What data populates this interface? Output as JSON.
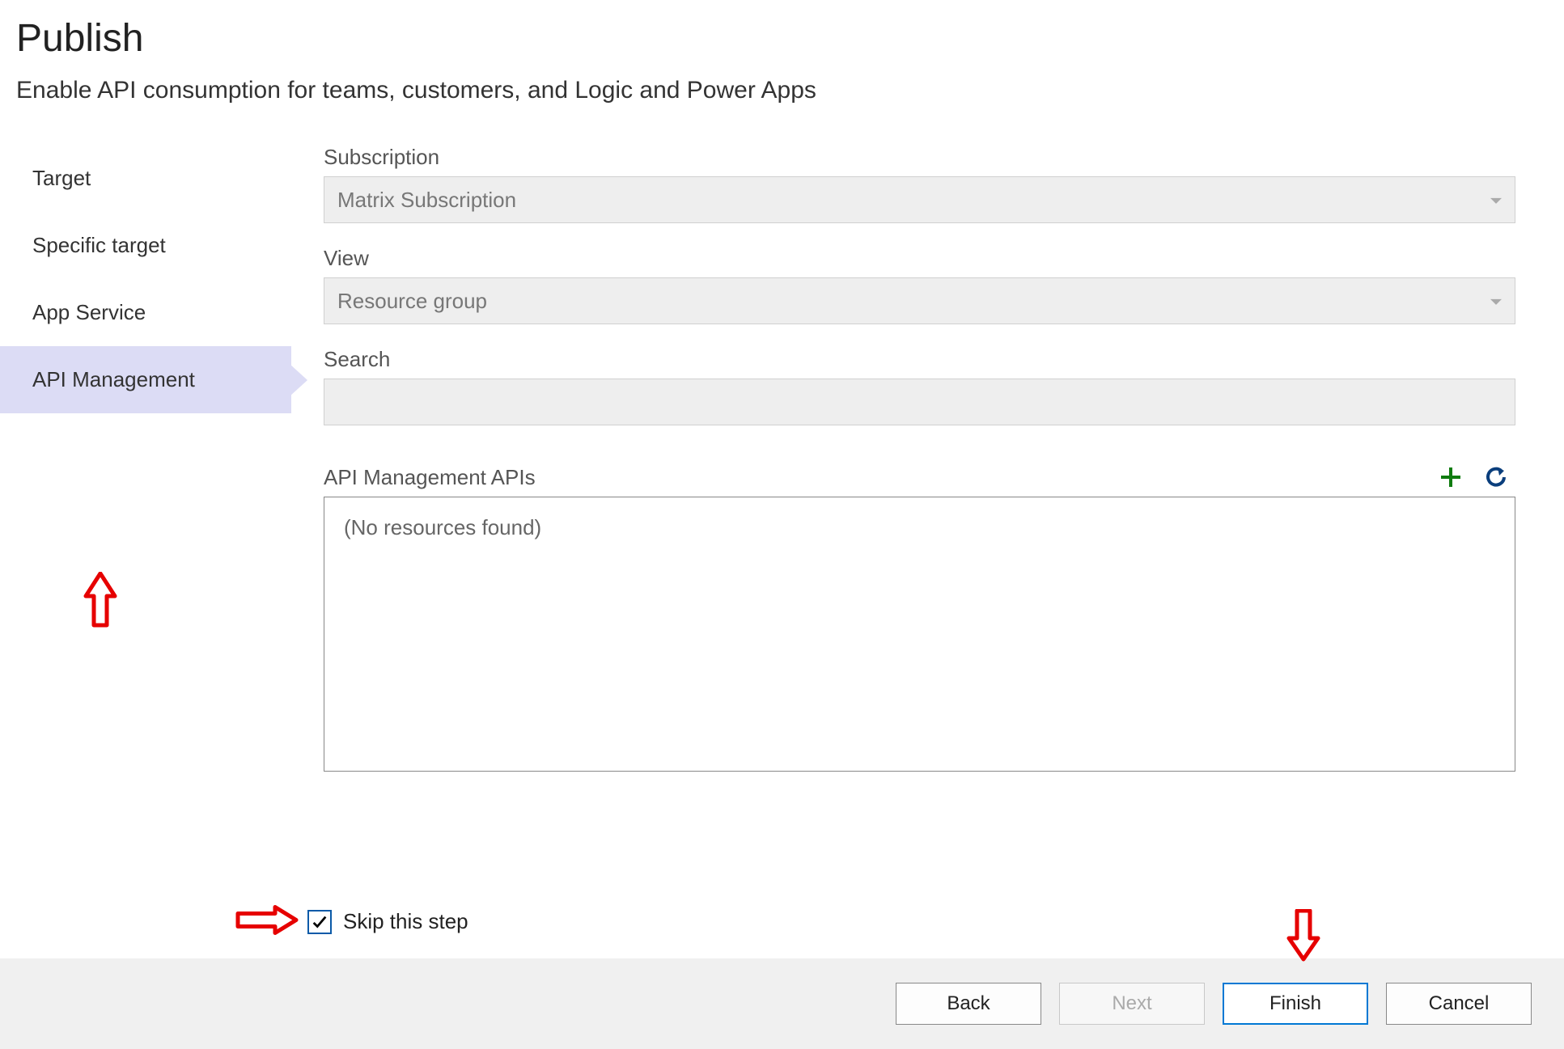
{
  "header": {
    "title": "Publish",
    "subtitle": "Enable API consumption for teams, customers, and Logic and Power Apps"
  },
  "sidebar": {
    "items": [
      {
        "label": "Target",
        "active": false
      },
      {
        "label": "Specific target",
        "active": false
      },
      {
        "label": "App Service",
        "active": false
      },
      {
        "label": "API Management",
        "active": true
      }
    ]
  },
  "form": {
    "subscription_label": "Subscription",
    "subscription_value": "Matrix Subscription",
    "view_label": "View",
    "view_value": "Resource group",
    "search_label": "Search",
    "search_value": "",
    "apis_label": "API Management APIs",
    "apis_empty": "(No resources found)",
    "add_icon": "plus-icon",
    "refresh_icon": "refresh-icon"
  },
  "skip": {
    "checked": true,
    "label": "Skip this step"
  },
  "footer": {
    "back": "Back",
    "next": "Next",
    "finish": "Finish",
    "cancel": "Cancel",
    "next_enabled": false,
    "finish_highlighted": true
  },
  "colors": {
    "active_step_bg": "#dcdcf5",
    "primary": "#0078d4",
    "add_icon": "#107c10",
    "refresh_icon": "#0a3e7c",
    "annotation": "#e60000"
  }
}
